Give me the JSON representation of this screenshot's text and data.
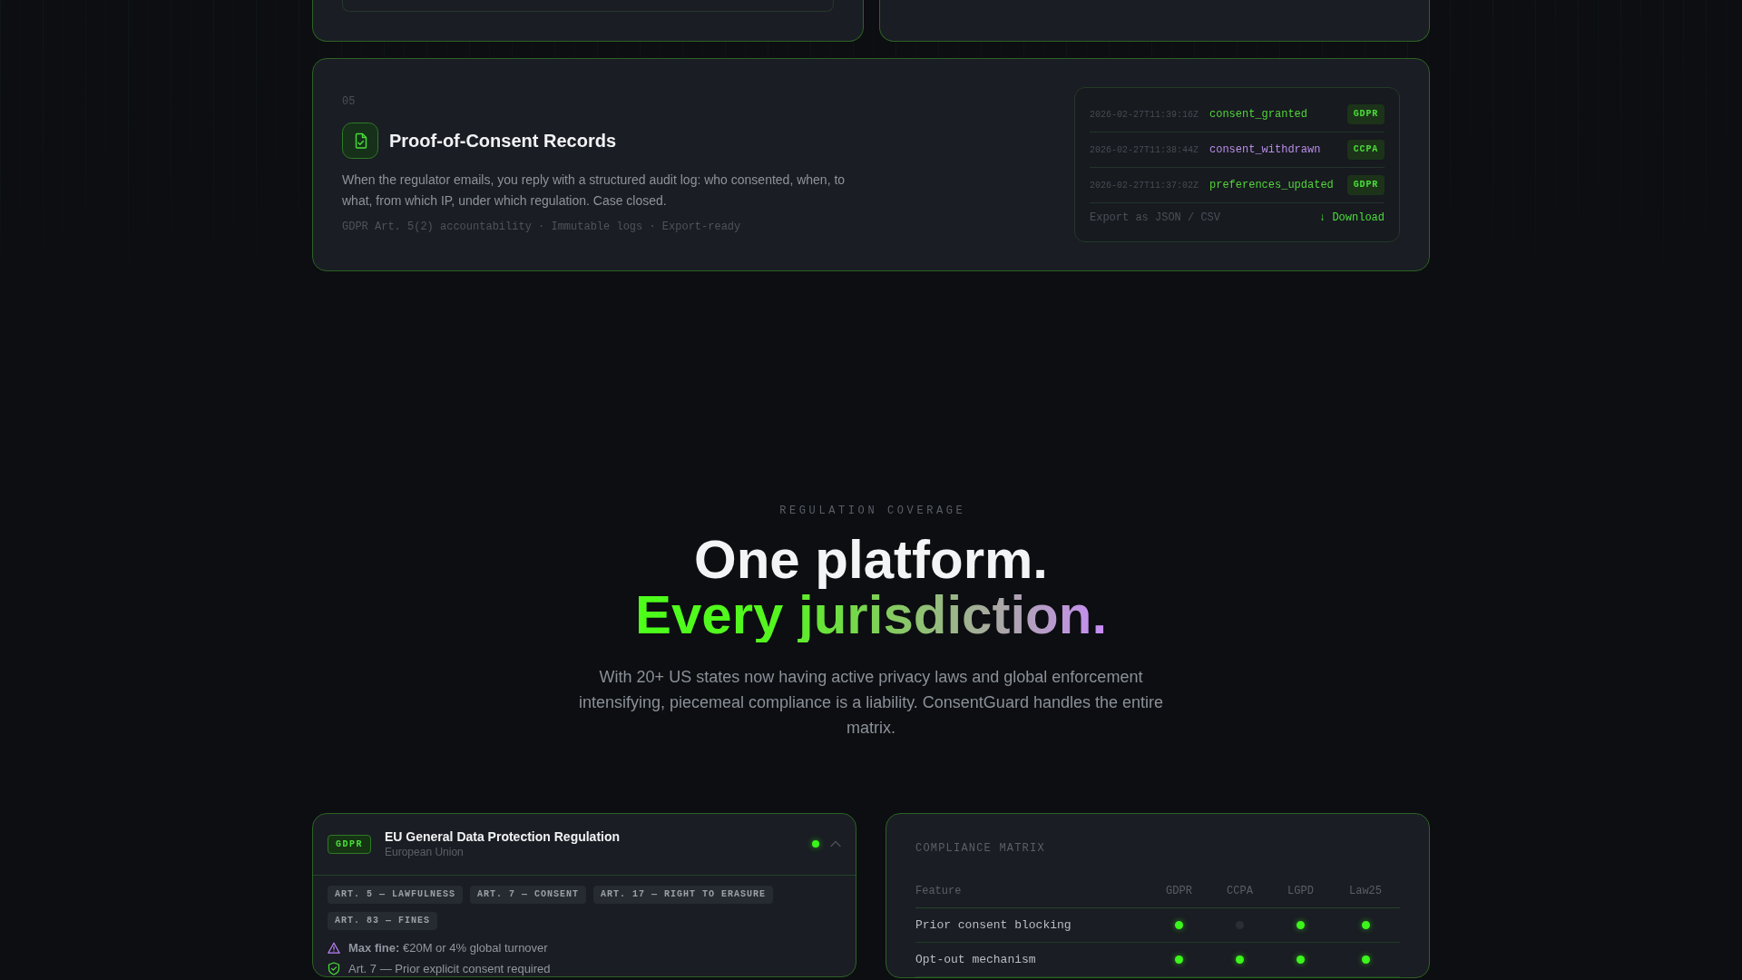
{
  "cards_above": [
    {
      "kind": "with_panel"
    },
    {
      "kind": "plain"
    }
  ],
  "feature": {
    "number": "05",
    "title": "Proof-of-Consent Records",
    "description": "When the regulator emails, you reply with a structured audit log: who consented, when, to what, from which IP, under which regulation. Case closed.",
    "tags": "GDPR Art. 5(2) accountability · Immutable logs · Export-ready",
    "log": {
      "entries": [
        {
          "timestamp": "2026-02-27T11:39:16Z",
          "event": "consent_granted",
          "color": "#53d43a",
          "regulation": "GDPR"
        },
        {
          "timestamp": "2026-02-27T11:38:44Z",
          "event": "consent_withdrawn",
          "color": "#b98ee8",
          "regulation": "CCPA"
        },
        {
          "timestamp": "2026-02-27T11:37:02Z",
          "event": "preferences_updated",
          "color": "#53d43a",
          "regulation": "GDPR"
        }
      ],
      "export_label": "Export as JSON / CSV",
      "download": "↓ Download"
    }
  },
  "coverage": {
    "eyebrow": "REGULATION COVERAGE",
    "title": "One platform.",
    "title_highlight": "Every jurisdiction.",
    "description": "With 20+ US states now having active privacy laws and global enforcement intensifying, piecemeal compliance is a liability. ConsentGuard handles the entire matrix."
  },
  "regulation_card": {
    "badge": "GDPR",
    "title": "EU General Data Protection Regulation",
    "region": "European Union",
    "active": true,
    "expanded": true,
    "articles": [
      "ART. 5 — LAWFULNESS",
      "ART. 7 — CONSENT",
      "ART. 17 — RIGHT TO ERASURE",
      "ART. 83 — FINES"
    ],
    "details": [
      {
        "kind": "warning",
        "text": "**Max fine:** €20M or 4% global turnover"
      },
      {
        "kind": "check",
        "text": "Art. 7 — Prior explicit consent required"
      }
    ]
  },
  "compliance_matrix": {
    "title": "COMPLIANCE MATRIX",
    "columns": [
      "Feature",
      "GDPR",
      "CCPA",
      "LGPD",
      "Law25"
    ],
    "rows": [
      {
        "feature": "Prior consent blocking",
        "cells": [
          {
            "supported": true
          },
          {
            "supported": false
          },
          {
            "supported": true
          },
          {
            "supported": true
          }
        ]
      },
      {
        "feature": "Opt-out mechanism",
        "cells": [
          {
            "supported": true
          },
          {
            "supported": true
          },
          {
            "supported": true
          },
          {
            "supported": true
          }
        ]
      }
    ]
  }
}
